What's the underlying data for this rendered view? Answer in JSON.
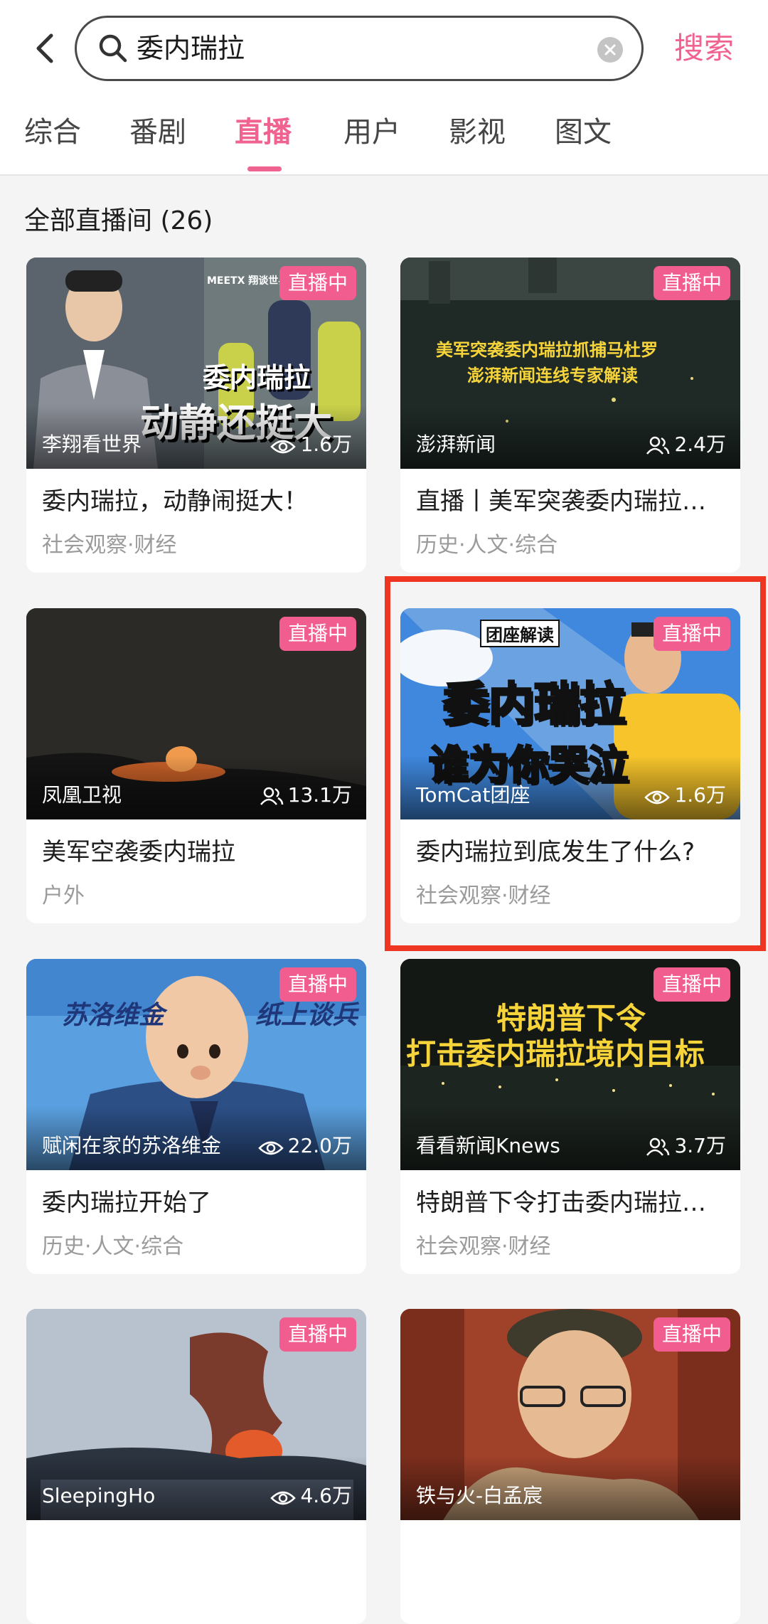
{
  "search": {
    "query": "委内瑞拉",
    "button_label": "搜索"
  },
  "tabs": [
    {
      "label": "综合"
    },
    {
      "label": "番剧"
    },
    {
      "label": "直播"
    },
    {
      "label": "用户"
    },
    {
      "label": "影视"
    },
    {
      "label": "图文"
    }
  ],
  "active_tab": "直播",
  "section_title": "全部直播间 (26)",
  "live_badge": "直播中",
  "cards": [
    {
      "streamer": "李翔看世界",
      "viewers": "1.6万",
      "viewer_icon": "eye-icon",
      "title": "委内瑞拉，动静闹挺大！",
      "tags": "社会观察·财经",
      "thumb_text_1": "委内瑞拉",
      "thumb_text_2": "动静还挺大",
      "thumb_logo": "MEETX 翔谈世界"
    },
    {
      "streamer": "澎湃新闻",
      "viewers": "2.4万",
      "viewer_icon": "people-icon",
      "title": "直播丨美军突袭委内瑞拉抓捕马杜罗",
      "tags": "历史·人文·综合",
      "thumb_text_1": "美军突袭委内瑞拉抓捕马杜罗",
      "thumb_text_2": "澎湃新闻连线专家解读"
    },
    {
      "streamer": "凤凰卫视",
      "viewers": "13.1万",
      "viewer_icon": "people-icon",
      "title": "美军空袭委内瑞拉",
      "tags": "户外"
    },
    {
      "streamer": "TomCat团座",
      "viewers": "1.6万",
      "viewer_icon": "eye-icon",
      "title": "委内瑞拉到底发生了什么?",
      "tags": "社会观察·财经",
      "thumb_text_0": "团座解读",
      "thumb_text_1": "委内瑞拉",
      "thumb_text_2": "谁为你哭泣"
    },
    {
      "streamer": "赋闲在家的苏洛维金",
      "viewers": "22.0万",
      "viewer_icon": "eye-icon",
      "title": "委内瑞拉开始了",
      "tags": "历史·人文·综合",
      "thumb_text_1": "苏洛维金",
      "thumb_text_2": "纸上谈兵"
    },
    {
      "streamer": "看看新闻Knews",
      "viewers": "3.7万",
      "viewer_icon": "people-icon",
      "title": "特朗普下令打击委内瑞拉境内目标",
      "tags": "社会观察·财经",
      "thumb_text_1": "特朗普下令",
      "thumb_text_2": "打击委内瑞拉境内目标"
    },
    {
      "streamer": "SleepingHo",
      "viewers": "4.6万",
      "viewer_icon": "eye-icon"
    },
    {
      "streamer": "铁与火-白孟宸",
      "viewer_icon": "people-icon"
    }
  ],
  "colors": {
    "accent": "#f0628f",
    "highlight_box": "#ee3622"
  }
}
